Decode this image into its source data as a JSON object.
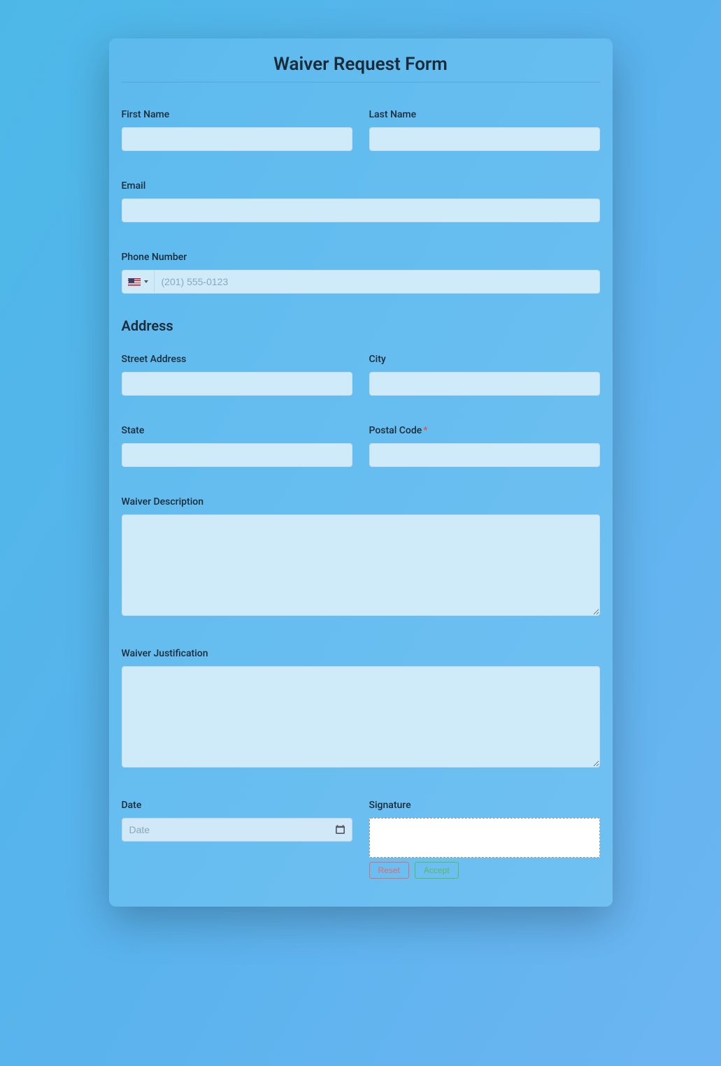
{
  "form": {
    "title": "Waiver Request Form",
    "first_name_label": "First Name",
    "last_name_label": "Last Name",
    "email_label": "Email",
    "phone_label": "Phone Number",
    "phone_placeholder": "(201) 555-0123",
    "phone_country": "us",
    "address_heading": "Address",
    "street_label": "Street Address",
    "city_label": "City",
    "state_label": "State",
    "postal_label": "Postal Code",
    "postal_required": true,
    "waiver_desc_label": "Waiver Description",
    "waiver_just_label": "Waiver Justification",
    "date_label": "Date",
    "date_placeholder": "Date",
    "signature_label": "Signature",
    "reset_label": "Reset",
    "accept_label": "Accept"
  }
}
